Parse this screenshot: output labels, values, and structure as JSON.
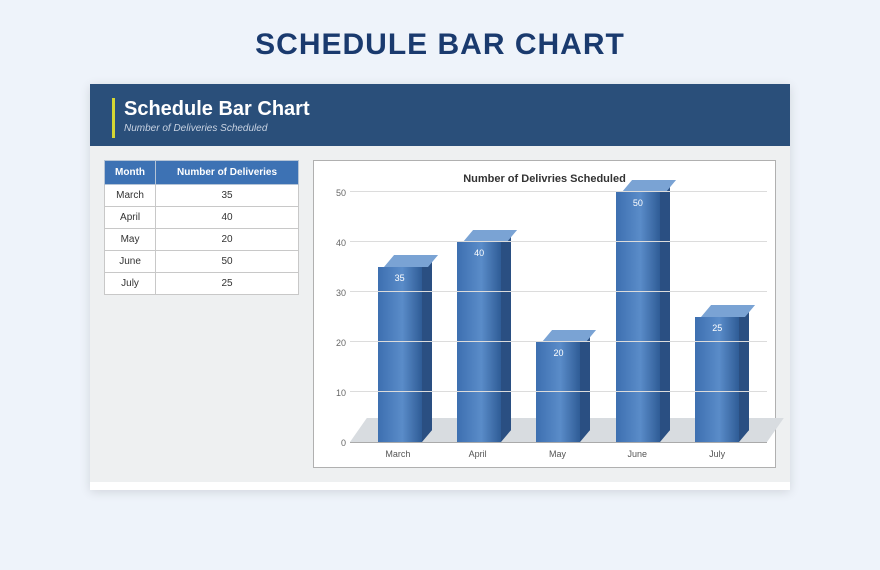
{
  "page_title": "SCHEDULE BAR CHART",
  "header": {
    "title": "Schedule Bar Chart",
    "subtitle": "Number of Deliveries Scheduled"
  },
  "table": {
    "headers": {
      "col1": "Month",
      "col2": "Number of Deliveries"
    },
    "rows": [
      {
        "month": "March",
        "value": "35"
      },
      {
        "month": "April",
        "value": "40"
      },
      {
        "month": "May",
        "value": "20"
      },
      {
        "month": "June",
        "value": "50"
      },
      {
        "month": "July",
        "value": "25"
      }
    ]
  },
  "chart_data": {
    "type": "bar",
    "title": "Number of Delivries Scheduled",
    "categories": [
      "March",
      "April",
      "May",
      "June",
      "July"
    ],
    "values": [
      35,
      40,
      20,
      50,
      25
    ],
    "xlabel": "",
    "ylabel": "",
    "ylim": [
      0,
      50
    ],
    "y_ticks": [
      0,
      10,
      20,
      30,
      40,
      50
    ]
  }
}
